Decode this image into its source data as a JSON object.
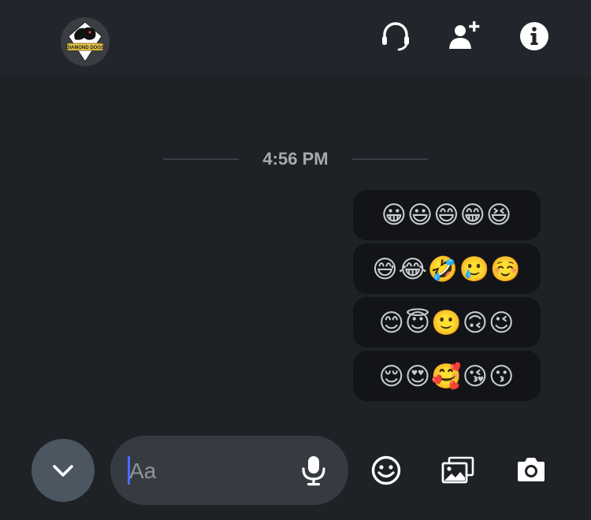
{
  "header": {
    "avatar_text": "DIAMOND DOGS",
    "icons": [
      "headset-icon",
      "add-friend-icon",
      "info-icon"
    ]
  },
  "conversation": {
    "timestamp": "4:56 PM",
    "messages": [
      {
        "text": "😀😃😄😁😆"
      },
      {
        "text": "😅😂🤣🥲☺️"
      },
      {
        "text": "😊😇🙂🙃😉"
      },
      {
        "text": "😌😍🥰😘😗"
      }
    ]
  },
  "composer": {
    "placeholder": "Aa",
    "value": ""
  },
  "colors": {
    "background": "#1e2126",
    "bubble": "#121417",
    "input": "#363b42",
    "caret": "#4a6bff"
  }
}
